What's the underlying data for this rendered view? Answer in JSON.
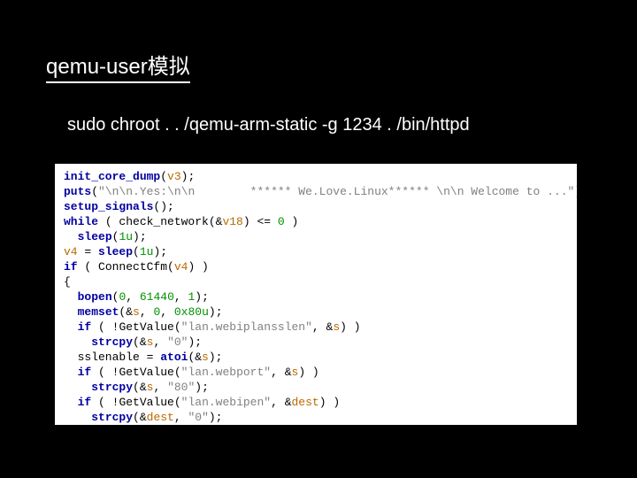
{
  "title": "qemu-user模拟",
  "command": "sudo chroot . . /qemu-arm-static -g 1234 . /bin/httpd",
  "code": {
    "l01a": "init_core_dump",
    "l01b": "(",
    "l01c": "v3",
    "l01d": ");",
    "l02a": "puts",
    "l02b": "(",
    "l02s": "\"\\n\\n.Yes:\\n\\n        ****** We.Love.Linux****** \\n\\n Welcome to ...\"",
    "l02c": ");",
    "l03a": "setup_signals",
    "l03b": "();",
    "l04a": "while",
    "l04b": " ( ",
    "l04c": "check_network",
    "l04d": "(&",
    "l04e": "v18",
    "l04f": ") <= ",
    "l04g": "0",
    "l04h": " )",
    "l05a": "  ",
    "l05b": "sleep",
    "l05c": "(",
    "l05d": "1u",
    "l05e": ");",
    "l06a": "v4",
    "l06b": " = ",
    "l06c": "sleep",
    "l06d": "(",
    "l06e": "1u",
    "l06f": ");",
    "l07a": "if",
    "l07b": " ( ",
    "l07c": "ConnectCfm",
    "l07d": "(",
    "l07e": "v4",
    "l07f": ") )",
    "l08a": "{",
    "l09a": "  ",
    "l09b": "bopen",
    "l09c": "(",
    "l09d": "0",
    "l09e": ", ",
    "l09f": "61440",
    "l09g": ", ",
    "l09h": "1",
    "l09i": ");",
    "l10a": "  ",
    "l10b": "memset",
    "l10c": "(&",
    "l10d": "s",
    "l10e": ", ",
    "l10f": "0",
    "l10g": ", ",
    "l10h": "0x80u",
    "l10i": ");",
    "l11a": "  ",
    "l11b": "if",
    "l11c": " ( !",
    "l11d": "GetValue",
    "l11e": "(",
    "l11f": "\"lan.webiplansslen\"",
    "l11g": ", &",
    "l11h": "s",
    "l11i": ") )",
    "l12a": "    ",
    "l12b": "strcpy",
    "l12c": "(&",
    "l12d": "s",
    "l12e": ", ",
    "l12f": "\"0\"",
    "l12g": ");",
    "l13a": "  sslenable = ",
    "l13b": "atoi",
    "l13c": "(&",
    "l13d": "s",
    "l13e": ");",
    "l14a": "  ",
    "l14b": "if",
    "l14c": " ( !",
    "l14d": "GetValue",
    "l14e": "(",
    "l14f": "\"lan.webport\"",
    "l14g": ", &",
    "l14h": "s",
    "l14i": ") )",
    "l15a": "    ",
    "l15b": "strcpy",
    "l15c": "(&",
    "l15d": "s",
    "l15e": ", ",
    "l15f": "\"80\"",
    "l15g": ");",
    "l16a": "  ",
    "l16b": "if",
    "l16c": " ( !",
    "l16d": "GetValue",
    "l16e": "(",
    "l16f": "\"lan.webipen\"",
    "l16g": ", &",
    "l16h": "dest",
    "l16i": ") )",
    "l17a": "    ",
    "l17b": "strcpy",
    "l17c": "(&",
    "l17d": "dest",
    "l17e": ", ",
    "l17f": "\"0\"",
    "l17g": ");"
  }
}
